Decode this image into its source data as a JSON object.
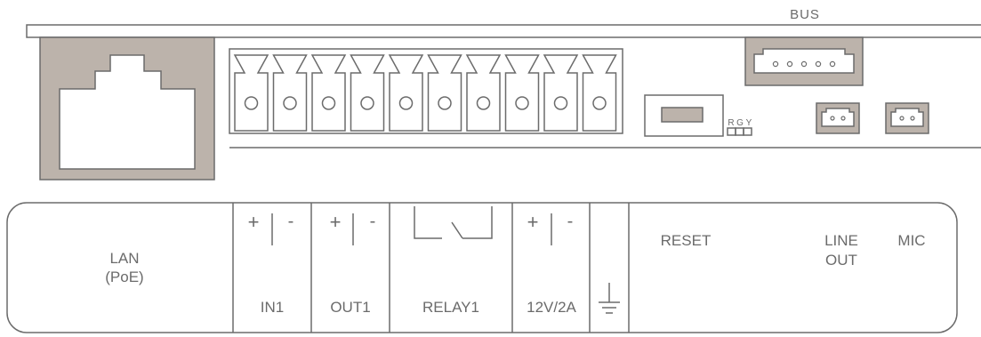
{
  "colors": {
    "stroke": "#6b6b6b",
    "port_fill": "#bcb3ab",
    "background": "#ffffff"
  },
  "board": {
    "bus_label": "BUS",
    "led_labels": [
      "R",
      "G",
      "Y"
    ],
    "terminal_count": 10
  },
  "panel": {
    "lan": {
      "line1": "LAN",
      "line2": "(PoE)"
    },
    "in1": {
      "plus": "+",
      "minus": "-",
      "label": "IN1"
    },
    "out1": {
      "plus": "+",
      "minus": "-",
      "label": "OUT1"
    },
    "relay1": {
      "label": "RELAY1"
    },
    "power": {
      "plus": "+",
      "minus": "-",
      "label": "12V/2A"
    },
    "ground": {
      "icon": "ground-icon"
    },
    "reset": {
      "label": "RESET"
    },
    "line_out": {
      "line1": "LINE",
      "line2": "OUT"
    },
    "mic": {
      "label": "MIC"
    }
  }
}
